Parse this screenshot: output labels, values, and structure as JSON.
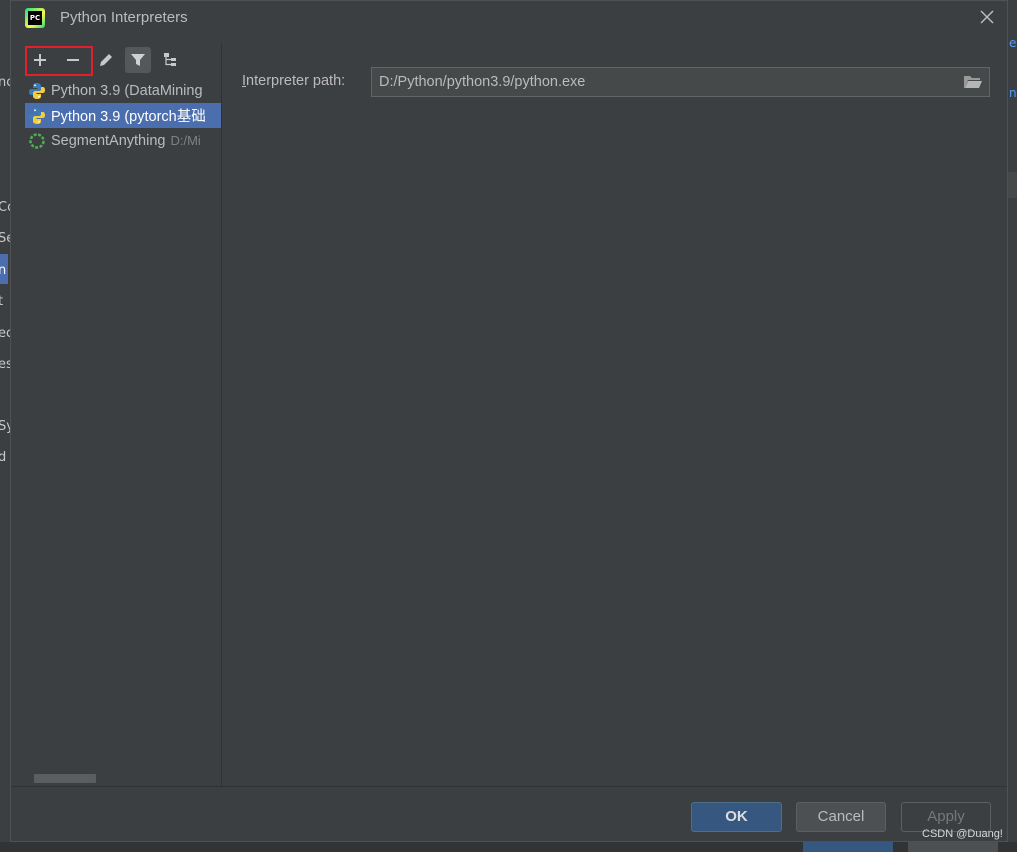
{
  "window": {
    "title": "Python Interpreters"
  },
  "toolbar": {
    "add_icon": "plus-icon",
    "remove_icon": "minus-icon",
    "edit_icon": "pencil-icon",
    "filter_icon": "filter-icon",
    "tree_icon": "tree-icon"
  },
  "interpreters": [
    {
      "name": "Python 3.9 (DataMining",
      "path": "",
      "icon": "python-icon",
      "selected": false
    },
    {
      "name": "Python 3.9 (pytorch基础",
      "path": "",
      "icon": "python-icon",
      "selected": true
    },
    {
      "name": "SegmentAnything",
      "path": "D:/Mi",
      "icon": "loading-spinner-icon",
      "selected": false
    }
  ],
  "details": {
    "path_label_mnemonic": "I",
    "path_label_rest": "nterpreter path:",
    "path_value": "D:/Python/python3.9/python.exe"
  },
  "buttons": {
    "ok": "OK",
    "cancel": "Cancel",
    "apply": "Apply"
  },
  "background": {
    "left_fragments": [
      "no",
      "Co",
      "Se",
      "n",
      "t",
      "ec",
      "es",
      "Sy",
      "d"
    ],
    "right_fragments": [
      "es",
      "nt"
    ]
  },
  "watermark": "CSDN @Duang!",
  "colors": {
    "dialog_bg": "#3c3f41",
    "selection": "#4b6eaf",
    "ok_button": "#365880",
    "highlight_box": "#e0202b"
  }
}
